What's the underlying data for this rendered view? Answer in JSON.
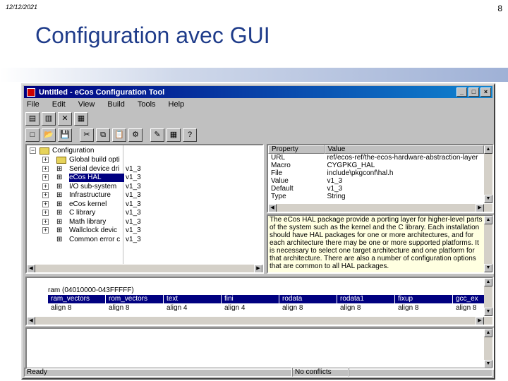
{
  "slide": {
    "date": "12/12/2021",
    "page_number": "8",
    "title": "Configuration avec GUI"
  },
  "window": {
    "title": "Untitled - eCos Configuration Tool",
    "buttons": [
      "_",
      "□",
      "×"
    ]
  },
  "menu": [
    "File",
    "Edit",
    "View",
    "Build",
    "Tools",
    "Help"
  ],
  "tree": {
    "root": "Configuration",
    "items": [
      {
        "label": "Global build opti",
        "version": "",
        "icon": "folder"
      },
      {
        "label": "Serial device dri",
        "version": "v1_3",
        "icon": "package"
      },
      {
        "label": "eCos HAL",
        "version": "v1_3",
        "icon": "package",
        "selected": true
      },
      {
        "label": "I/O sub-system",
        "version": "v1_3",
        "icon": "package"
      },
      {
        "label": "Infrastructure",
        "version": "v1_3",
        "icon": "package"
      },
      {
        "label": "eCos kernel",
        "version": "v1_3",
        "icon": "package"
      },
      {
        "label": "C library",
        "version": "v1_3",
        "icon": "package"
      },
      {
        "label": "Math library",
        "version": "v1_3",
        "icon": "package"
      },
      {
        "label": "Wallclock devic",
        "version": "v1_3",
        "icon": "package"
      },
      {
        "label": "Common error c",
        "version": "v1_3",
        "icon": "package"
      }
    ]
  },
  "properties": {
    "headers": [
      "Property",
      "Value"
    ],
    "rows": [
      [
        "URL",
        "ref/ecos-ref/the-ecos-hardware-abstraction-layer"
      ],
      [
        "Macro",
        "CYGPKG_HAL"
      ],
      [
        "File",
        "include\\pkgconf\\hal.h"
      ],
      [
        "Value",
        "v1_3"
      ],
      [
        "Default",
        "v1_3"
      ],
      [
        "Type",
        "String"
      ]
    ]
  },
  "description": "The eCos HAL package provide a porting layer for higher-level parts of the system such as the kernel and the C library. Each installation should have HAL packages for one or more architectures, and for each architecture there may be one or more supported platforms. It is necessary to select one target architecture and one platform for that architecture. There are also a number of configuration options that are common to all HAL packages.",
  "sections": {
    "region": "ram (04010000-043FFFFF)",
    "headers": [
      "ram_vectors",
      "rom_vectors",
      "text",
      "fini",
      "rodata",
      "rodata1",
      "fixup",
      "gcc_ex"
    ],
    "values": [
      "align 8",
      "align 8",
      "align 4",
      "align 4",
      "align 8",
      "align 8",
      "align 8",
      "align 8"
    ]
  },
  "status": {
    "left": "Ready",
    "right": "No conflicts"
  },
  "toolbar1": [
    "▤",
    "▥",
    "✕",
    "▦"
  ],
  "toolbar2": [
    "□",
    "📂",
    "💾",
    "✂",
    "⧉",
    "📋",
    "⚙",
    "✎",
    "▦",
    "?"
  ],
  "colors": {
    "title_blue": "#1f3c8a",
    "titlebar": "#000080",
    "chrome": "#c0c0c0",
    "description_bg": "#ffffe1"
  }
}
